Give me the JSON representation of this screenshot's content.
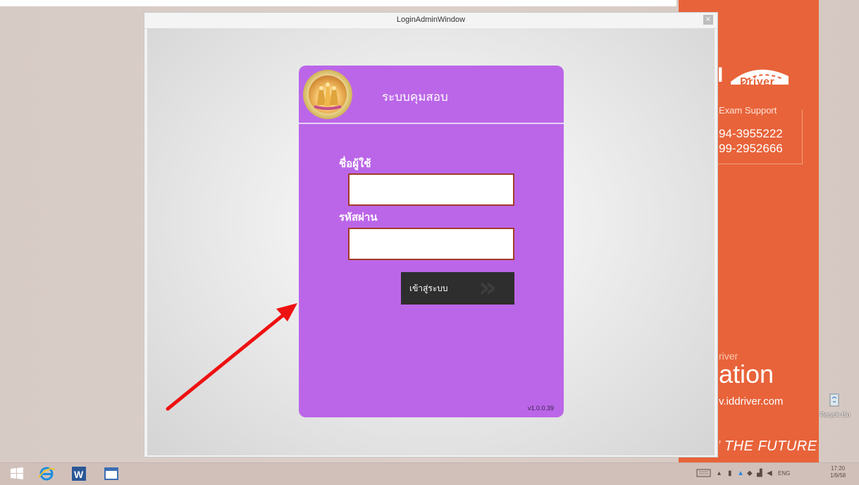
{
  "desktop": {
    "support_title": "Exam Support",
    "phone_1": "94-3955222",
    "phone_2": "99-2952666",
    "brand_fragment": "river",
    "logo_text": "Driver",
    "tagline_fragment": "ation",
    "website_fragment": "v.iddriver.com",
    "future_text": "THE FUTURE",
    "recycle_bin_label": "Recycle Bin",
    "accent_color": "#e8633a"
  },
  "window": {
    "title": "LoginAdminWindow",
    "close_glyph": "×"
  },
  "login": {
    "title": "ระบบคุมสอบ",
    "username_label": "ชื่อผู้ใช้",
    "username_value": "",
    "password_label": "รหัสผ่าน",
    "password_value": "",
    "login_button": "เข้าสู่ระบบ",
    "version": "v1.0.0.39",
    "card_color": "#bb66e8"
  },
  "taskbar": {
    "apps": [
      "windows-start-icon",
      "internet-explorer-icon",
      "word-icon",
      "window-icon"
    ],
    "language": "ENG",
    "time": "17:20",
    "date": "1/9/58"
  }
}
